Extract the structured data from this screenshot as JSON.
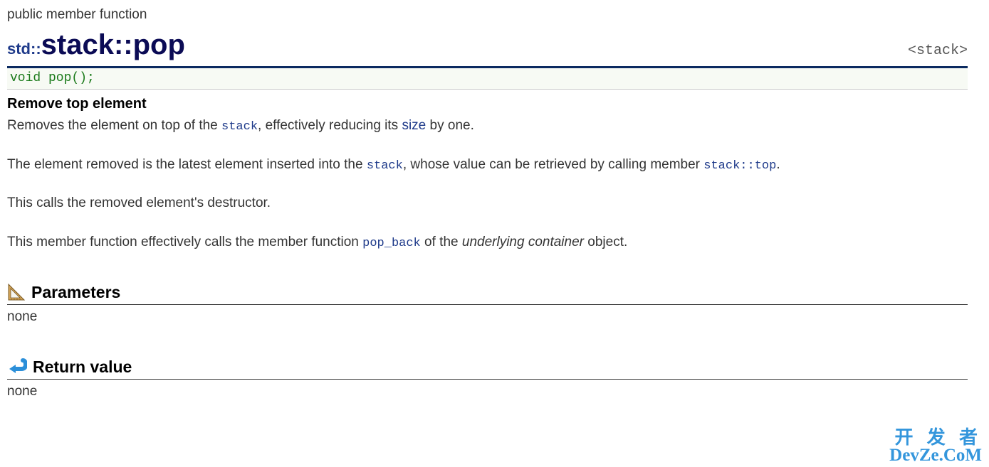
{
  "category": "public member function",
  "title": {
    "namespace": "std::",
    "classname": "stack",
    "sep": "::",
    "funcname": "pop"
  },
  "header_tag": "<stack>",
  "signature": "void pop();",
  "subtitle": "Remove top element",
  "paragraphs": {
    "p1_a": "Removes the element on top of the ",
    "p1_stack": "stack",
    "p1_b": ", effectively reducing its ",
    "p1_size": "size",
    "p1_c": " by one.",
    "p2_a": "The element removed is the latest element inserted into the ",
    "p2_stack": "stack",
    "p2_b": ", whose value can be retrieved by calling member ",
    "p2_top": "stack::top",
    "p2_c": ".",
    "p3": "This calls the removed element's destructor.",
    "p4_a": "This member function effectively calls the member function ",
    "p4_popback": "pop_back",
    "p4_b": " of the ",
    "p4_italic": "underlying container",
    "p4_c": " object."
  },
  "sections": {
    "parameters": {
      "heading": "Parameters",
      "content": "none"
    },
    "return_value": {
      "heading": "Return value",
      "content": "none"
    }
  },
  "watermark": {
    "line1": "开 发 者",
    "line2": "DevZe.CoM"
  }
}
